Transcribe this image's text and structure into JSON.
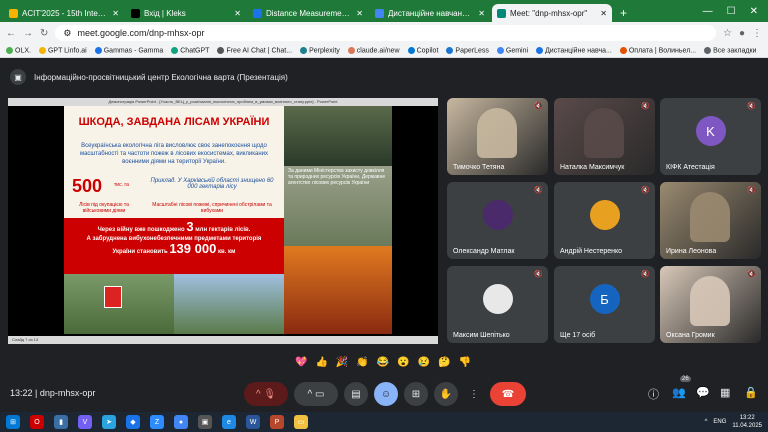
{
  "browser": {
    "tabs": [
      {
        "label": "ACIT'2025 - 15th International",
        "color": "#f4b400",
        "active": false
      },
      {
        "label": "Вхід | Kleks",
        "color": "#000000",
        "active": false
      },
      {
        "label": "Distance Measurement using A",
        "color": "#1a73e8",
        "active": false
      },
      {
        "label": "Дистанційне навчання в ВСП",
        "color": "#4285f4",
        "active": false
      },
      {
        "label": "Meet: \"dnp-mhsx-opr\"",
        "color": "#00897b",
        "active": true
      }
    ],
    "url": "meet.google.com/dnp-mhsx-opr",
    "bookmarks": [
      "OLX.",
      "GPT Linfo.ai",
      "Gammas - Gamma",
      "ChatGPT",
      "Free AI Chat | Chat...",
      "Perplexity",
      "claude.ai/new",
      "Copilot",
      "PaperLess",
      "Gemini",
      "Дистанційне навча...",
      "Оплата | Волиньел...",
      "Все закладки"
    ]
  },
  "meeting": {
    "presenter_label": "Інформаційно-просвітницький центр Екологічна варта (Презентація)",
    "time": "13:22",
    "code": "dnp-mhsx-opr",
    "participants_count": "26"
  },
  "slide": {
    "window_title": "Демонстрація PowerPoint - [Участь_ВЕЦ_у_розв'язанні_екологічних_проблем_в_умовах_воєнного_стану.pptx] - PowerPoint",
    "title": "ШКОДА, ЗАВДАНА ЛІСАМ УКРАЇНИ",
    "para": "Всеукраїнська екологічна ліга висловлює своє занепокоєння щодо масштабності та частоти пожеж в лісових екосистемах, викликаних воєнними діями на території України.",
    "stat_num": "500",
    "stat_unit": "тис. га",
    "stat_desc": "Лісів під окупацією та військовими діями",
    "kharkiv": "Приклад. У Харківській області знищено 60 000 гектарів лісу",
    "kharkiv_desc": "Масштабні лісові пожежі, спричинені обстрілами та вибухами",
    "red_line1": "Через війну вже пошкоджено",
    "red_num": "3",
    "red_line1b": "млн гектарів лісів.",
    "red_line2": "А забруднена вибухонебезпечними предметами територія",
    "red_line3": "України становить",
    "red_big": "139 000",
    "red_unit": "кв. км",
    "right_text": "За даними Міністерства захисту довкілля та природних ресурсів України, Державне агентство лісових ресурсів України",
    "status": "Слайд 7 из 13"
  },
  "participants": [
    {
      "name": "Тимочко Тетяна",
      "type": "video",
      "bg": "#c8b8a0"
    },
    {
      "name": "Наталка Максимчук",
      "type": "video",
      "bg": "#5a4a4a"
    },
    {
      "name": "КІФК Атестація",
      "type": "avatar",
      "letter": "K",
      "bg": "#7e57c2"
    },
    {
      "name": "Олександр Матлак",
      "type": "avatar",
      "letter": "",
      "bg": "#4a2a6a"
    },
    {
      "name": "Андрій Нестеренко",
      "type": "avatar",
      "letter": "",
      "bg": "#e8a020"
    },
    {
      "name": "Ирина Леонова",
      "type": "video",
      "bg": "#9a8a70"
    },
    {
      "name": "Максим Шепітько",
      "type": "avatar",
      "letter": "",
      "bg": "#e8e8e8"
    },
    {
      "name": "Ще 17 осіб",
      "type": "avatar",
      "letter": "Б",
      "bg": "#1565c0"
    },
    {
      "name": "Оксана Громик",
      "type": "video",
      "bg": "#d8c8b8"
    }
  ],
  "reactions": [
    "💖",
    "👍",
    "🎉",
    "👏",
    "😂",
    "😮",
    "😢",
    "🤔",
    "👎"
  ],
  "taskbar": {
    "lang": "ENG",
    "clock": "13:22",
    "date": "11.04.2025"
  }
}
